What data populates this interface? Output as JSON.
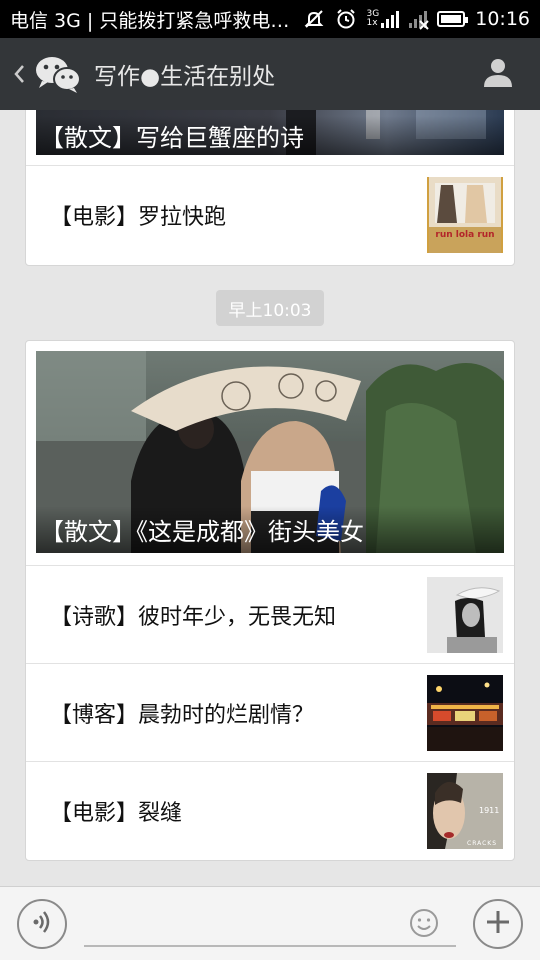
{
  "status_bar": {
    "carrier_text": "电信 3G | 只能拨打紧急呼救电…",
    "network_type": "3G",
    "network_sub": "1x",
    "time": "10:16",
    "icons": [
      "bell-off-icon",
      "alarm-icon",
      "signal-icon",
      "no-signal-icon",
      "battery-icon"
    ]
  },
  "nav": {
    "title": "写作●生活在别处",
    "back_icon": "chevron-left-icon",
    "logo_icon": "wechat-logo-icon",
    "profile_icon": "person-icon"
  },
  "timeline": {
    "earlier_card": {
      "hero_title": "【散文】写给巨蟹座的诗",
      "items": [
        {
          "title": "【电影】罗拉快跑",
          "thumb_text": "run lola run"
        }
      ]
    },
    "timestamp": "早上10:03",
    "card": {
      "hero_title": "【散文】《这是成都》街头美女",
      "items": [
        {
          "title": "【诗歌】彼时年少，无畏无知"
        },
        {
          "title": "【博客】晨勃时的烂剧情？"
        },
        {
          "title": "【电影】裂缝",
          "thumb_text": "CRACKS"
        }
      ]
    }
  },
  "input_bar": {
    "placeholder": "",
    "voice_icon": "voice-icon",
    "emoji_icon": "emoji-icon",
    "plus_icon": "plus-icon"
  },
  "colors": {
    "nav_bg": "#333639",
    "page_bg": "#e6e6e6",
    "card_bg": "#ffffff",
    "timestamp_bg": "#d2d2d2"
  }
}
